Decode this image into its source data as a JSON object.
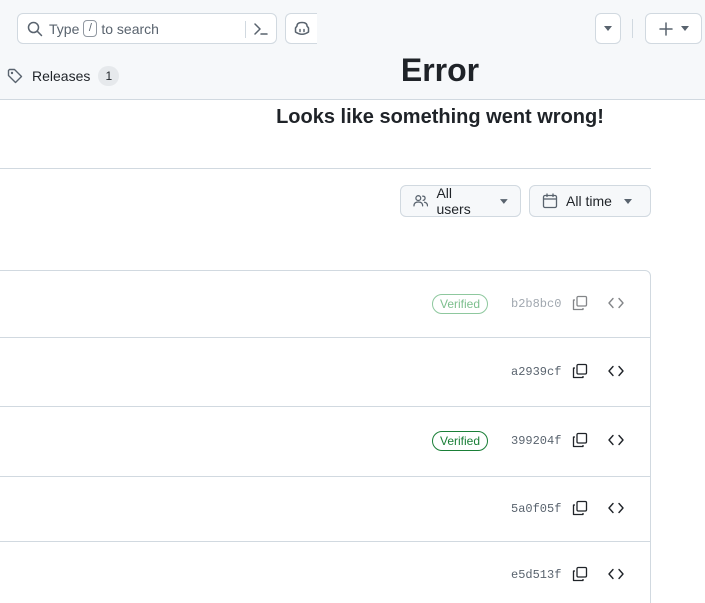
{
  "header": {
    "search": {
      "type_text": "Type",
      "key_hint": "/",
      "rest_text": "to search"
    }
  },
  "repo_nav": {
    "releases_label": "Releases",
    "releases_count": "1"
  },
  "error": {
    "title": "Error",
    "message": "Looks like something went wrong!"
  },
  "filters": {
    "users_label": "All users",
    "time_label": "All time"
  },
  "commits": [
    {
      "sha": "b2b8bc0",
      "verified": true,
      "verified_label": "Verified"
    },
    {
      "sha": "a2939cf",
      "verified": false,
      "verified_label": ""
    },
    {
      "sha": "399204f",
      "verified": true,
      "verified_label": "Verified"
    },
    {
      "sha": "5a0f05f",
      "verified": false,
      "verified_label": ""
    },
    {
      "sha": "e5d513f",
      "verified": false,
      "verified_label": ""
    }
  ],
  "colors": {
    "verified_green": "#1a7f37",
    "border": "#d1d9e0",
    "header_bg": "#f6f8fa"
  }
}
